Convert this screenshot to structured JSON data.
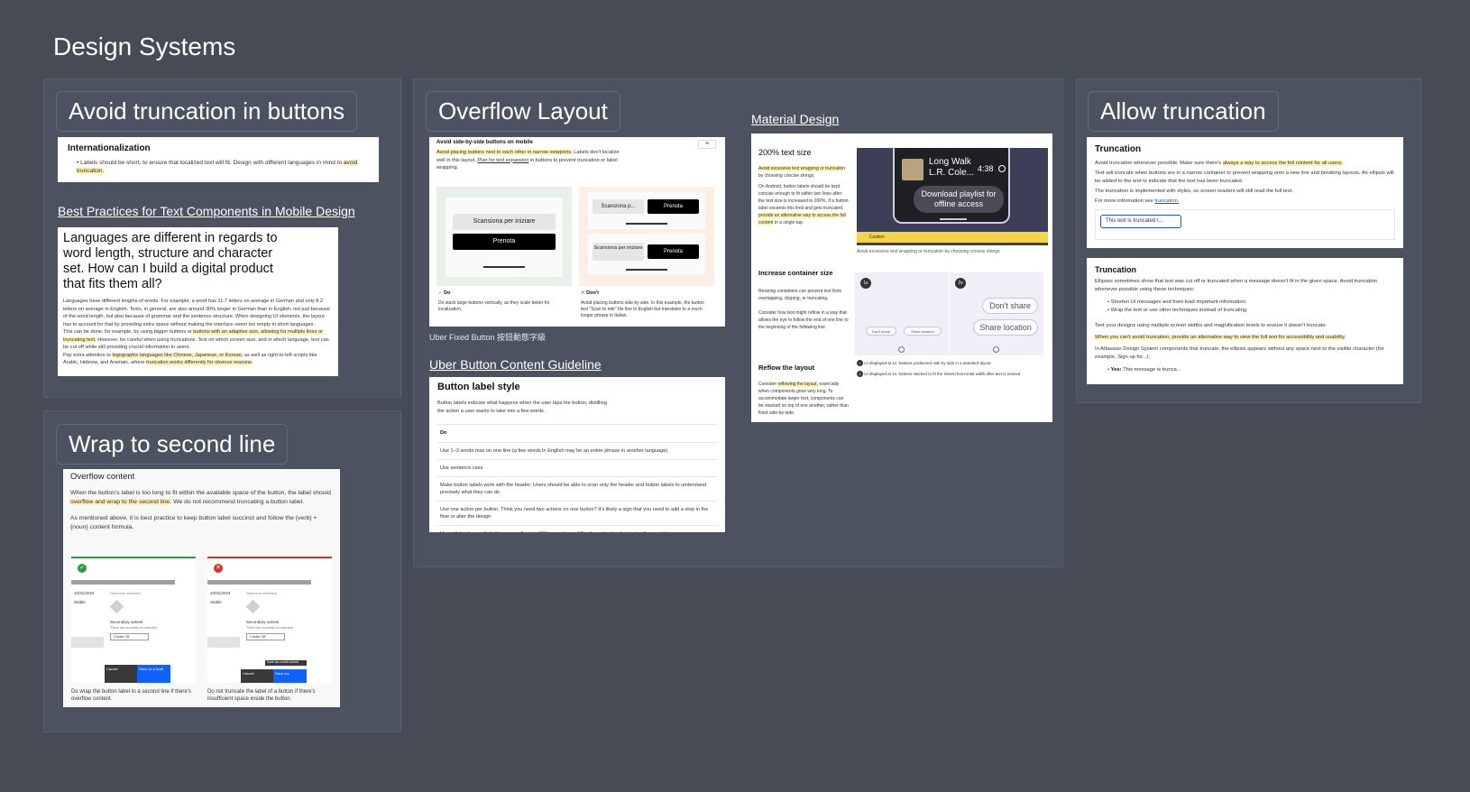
{
  "page": {
    "title": "Design Systems"
  },
  "sections": {
    "avoid": {
      "title": "Avoid truncation in buttons",
      "intl_heading": "Internationalization",
      "intl_text": "Labels should be short, to ensure that localized text will fit. Design with different languages in mind to",
      "intl_highlight": "avoid truncation.",
      "best_link": "Best Practices for Text Components in Mobile Design",
      "best_heading": "Languages are different in regards to word length, structure and character set. How can I build a digital product that fits them all?",
      "best_p1": "Languages have different lengths of words. For example, a word has 11.7 letters on average in German and only 8.2 letters on average in English. Texts, in general, are also around 30% longer in German than in English, not just because of the word length, but also because of grammar and the sentence structure. When designing UI elements, the layout has to account for that by providing extra space without making the interface seem too empty in short languages.",
      "best_p2_a": "This can be done, for example, by using bigger buttons or",
      "best_p2_hl": "buttons with an adaptive size, allowing for multiple lines or truncating text.",
      "best_p2_b": "However, be careful when using truncations. Text on which screen size, and in which language, text can be cut off while still providing crucial information to users.",
      "best_p3_a": "Pay extra attention to",
      "best_p3_hl": "logographic languages like Chinese, Japanese, or Korean,",
      "best_p3_b": "as well as right-to-left scripts like Arabic, Hebrew, and Aramaic, where",
      "best_p3_hl2": "truncation works differently for obvious reasons."
    },
    "wrap": {
      "title": "Wrap to second line",
      "heading": "Overflow content",
      "p1_a": "When the button's label is too long to fit within the available space of the button, the label should",
      "p1_hl": "overflow and wrap to the second line.",
      "p1_b": "We do not recommend truncating a button label.",
      "p2": "As mentioned above, it is best practice to keep button label succinct and follow the {verb} + {noun} content formula.",
      "date": "10/31/2024",
      "status": "Stable",
      "panel_title": "Resource selection",
      "sub_title": "Secondary subnet",
      "sub_desc": "There are currently no subnets.",
      "dropdown": "Create Off",
      "cancel": "Cancel",
      "cta": "Save as a draft",
      "tooltip": "Save as a draft subnet",
      "do_caption": "Do wrap the button label to a second line if there's overflow content.",
      "dont_caption": "Do not truncate the label of a button if there's insufficient space inside the button."
    },
    "overflow": {
      "title": "Overflow Layout",
      "card_heading": "Avoid side-by-side buttons on mobile",
      "card_hl": "Avoid placing buttons next to each other in narrow viewports.",
      "card_text_a": "Labels don't localize well in this layout.",
      "card_link": "Plan for text expansion",
      "card_text_b": "in buttons to prevent truncation or label wrapping.",
      "scan_label": "Scansiona per iniziare",
      "scan_trunc": "Scansiona p...",
      "scan_wrap": "Scansiona per iniziare",
      "book_label": "Prenota",
      "do_label": "Do",
      "dont_label": "Don't",
      "do_caption": "Do stack large buttons vertically, as they scale better for localization.",
      "dont_caption": "Avoid placing buttons side by side. In this example, the button text \"Scan to ride\" fits fine in English but translates to a much longer phrase in Italian.",
      "uber_fixed": "Uber Fixed Button 按鈕動態字級",
      "uber_link": "Uber Button Content Guideline",
      "uber_heading": "Button label style",
      "uber_intro": "Button labels indicate what happens when the user taps the button, distilling the action a user wants to take into a few words.",
      "uber_do": "Do",
      "uber_rows": [
        "Use 1–3 words max on one line (a few words in English may be an entire phrase in another language)",
        "Use sentence case",
        "Make button labels work with the header. Users should be able to scan only the header and button labels to understand precisely what they can do",
        "Use one action per button. Think you need two actions on one button? It's likely a sign that you need to add a step in the flow or alter the design",
        "Use articles (a, an, the), the space allowing. ESL users have difficulty understanding text with no articles"
      ],
      "material_link": "Material Design",
      "m_heading1": "200% text size",
      "m_hl1": "Avoid excessive text wrapping or truncation",
      "m_text1_b": "by choosing concise strings.",
      "m_text2": "On Android, button labels should be kept concise enough to fit within two lines after the text size is increased to 200%. If a button label exceeds this limit and gets truncated,",
      "m_hl2": "provide an alternative way to access the full content",
      "m_text2_b": "in a single tap.",
      "m_track": "Long Walk",
      "m_artist": "L.R. Cole...",
      "m_time": "4:38",
      "m_download": "Download playlist for offline access",
      "m_caution": "Caution",
      "m_caution_caption": "Avoid excessive text wrapping or truncation by choosing concise strings",
      "m_heading2": "Increase container size",
      "m_text3": "Resizing containers can prevent text from overlapping, clipping, or truncating.",
      "m_text4": "Consider how text might reflow in a way that allows the eye to follow the end of one line to the beginning of the following line.",
      "m_1x": "1x",
      "m_2x": "2x",
      "m_dont_share": "Don't share",
      "m_share_loc": "Share location",
      "m_dont_share_small": "Don't share",
      "m_share_small": "Share location",
      "m_heading3": "Reflow the layout",
      "m_text5_a": "Consider",
      "m_hl3": "reflowing the layout,",
      "m_text5_b": "especially when components grow very long. To accommodate larger text, components can be stacked on top of one another, rather than fixed side-by-side.",
      "m_note1": "UI displayed at 1x: buttons positioned side by side in a standard layout",
      "m_note2": "UI displayed at 2x: buttons stacked to fit the limited horizontal width after text is resized"
    },
    "allow": {
      "title": "Allow truncation",
      "c1_heading": "Truncation",
      "c1_p1_a": "Avoid truncation whenever possible. Make sure there's",
      "c1_p1_hl": "always a way to access the full content for all users.",
      "c1_p2": "Text will truncate when buttons are in a narrow container to prevent wrapping onto a new line and breaking layouts. An ellipsis will be added to the end to indicate that the text has been truncated.",
      "c1_p3": "The truncation is implemented with styles, so screen readers will still read the full text.",
      "c1_p4_a": "For more information see",
      "c1_p4_link": "truncation.",
      "c1_button": "This text is truncated t...",
      "c2_heading": "Truncation",
      "c2_p1": "Ellipses sometimes show that text was cut off or truncated when a message doesn't fit in the given space. Avoid truncation whenever possible using these techniques:",
      "c2_bullets": [
        "Shorten UI messages and front-load important information.",
        "Wrap the text or use other techniques instead of truncating."
      ],
      "c2_p2": "Test your designs using multiple screen widths and magnification levels to ensure it doesn't truncate.",
      "c2_hl": "When you can't avoid truncation, provide an alternative way to view the full text for accessibility and usability.",
      "c2_p3": "In Atlassian Design System components that truncate, the ellipsis appears without any space next to the visible character (for example, Sign up for...).",
      "c2_yes_label": "Yes:",
      "c2_yes_text": "This message is trunca..."
    }
  },
  "colors": {
    "background": "#474b56",
    "section": "#4d5260",
    "highlight": "#fff2b3",
    "do_green": "#2e9b47",
    "dont_red": "#d93025",
    "caution_yellow": "#f5d547"
  }
}
